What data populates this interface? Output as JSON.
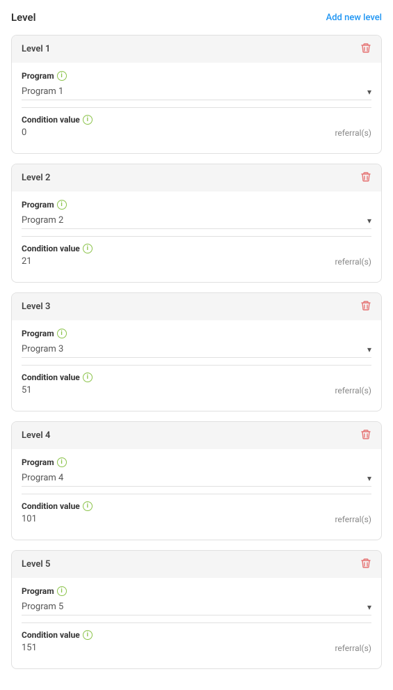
{
  "header": {
    "title": "Level",
    "add_button_label": "Add new level"
  },
  "levels": [
    {
      "id": 1,
      "title": "Level 1",
      "program_label": "Program",
      "program_value": "Program 1",
      "condition_label": "Condition value",
      "condition_value": "0",
      "referrals_label": "referral(s)"
    },
    {
      "id": 2,
      "title": "Level 2",
      "program_label": "Program",
      "program_value": "Program 2",
      "condition_label": "Condition value",
      "condition_value": "21",
      "referrals_label": "referral(s)"
    },
    {
      "id": 3,
      "title": "Level 3",
      "program_label": "Program",
      "program_value": "Program 3",
      "condition_label": "Condition value",
      "condition_value": "51",
      "referrals_label": "referral(s)"
    },
    {
      "id": 4,
      "title": "Level 4",
      "program_label": "Program",
      "program_value": "Program 4",
      "condition_label": "Condition value",
      "condition_value": "101",
      "referrals_label": "referral(s)"
    },
    {
      "id": 5,
      "title": "Level 5",
      "program_label": "Program",
      "program_value": "Program 5",
      "condition_label": "Condition value",
      "condition_value": "151",
      "referrals_label": "referral(s)"
    }
  ],
  "icons": {
    "delete": "🗑",
    "info": "i",
    "dropdown": "▾"
  }
}
